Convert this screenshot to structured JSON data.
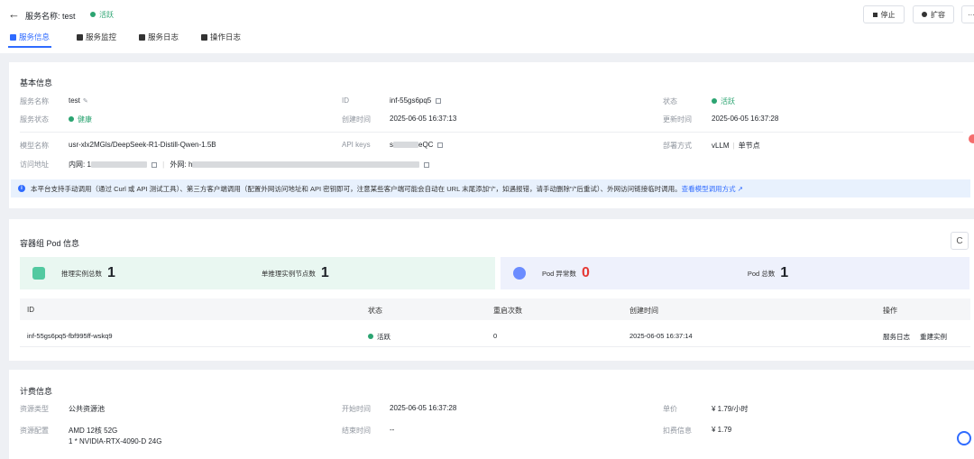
{
  "header": {
    "back_glyph": "←",
    "title": "服务名称: test",
    "status": "活跃",
    "stop_label": "停止",
    "scale_label": "扩容",
    "more_label": "···"
  },
  "tabs": [
    {
      "label": "服务信息"
    },
    {
      "label": "服务监控"
    },
    {
      "label": "服务日志"
    },
    {
      "label": "操作日志"
    }
  ],
  "basic": {
    "title": "基本信息",
    "service_name_label": "服务名称",
    "service_name_value": "test",
    "id_label": "ID",
    "id_value": "inf-55gs6pq5",
    "status_label": "状态",
    "status_value": "活跃",
    "service_state_label": "服务状态",
    "service_state_value": "健康",
    "created_label": "创建时间",
    "created_value": "2025-06-05 16:37:13",
    "updated_label": "更新时间",
    "updated_value": "2025-06-05 16:37:28",
    "model_label": "模型名称",
    "model_value": "usr-xlx2MGls/DeepSeek-R1-Distill-Qwen-1.5B",
    "apikey_label": "API keys",
    "apikey_prefix": "s",
    "apikey_suffix": "eQC",
    "deploy_label": "部署方式",
    "deploy_value": "vLLM",
    "deploy_mode": "单节点",
    "access_label": "访问地址",
    "inner_label": "内网:",
    "inner_prefix": "1",
    "outer_label": "外网:",
    "outer_prefix": "h",
    "notice_text": "本平台支持手动调用（通过 Curl 或 API 测试工具）、第三方客户端调用（配置外网访问地址和 API 密钥即可，注意某些客户端可能会自动在 URL 末尾添加\"/\"，如遇报错，请手动删除\"/\"后重试）、外网访问链接临时调用。",
    "notice_link": "查看模型调用方式"
  },
  "pod": {
    "title": "容器组 Pod 信息",
    "refresh_glyph": "C",
    "total_label": "推理实例总数",
    "total_value": "1",
    "nodes_label": "单推理实例节点数",
    "nodes_value": "1",
    "abnormal_label": "Pod 异常数",
    "abnormal_value": "0",
    "pod_total_label": "Pod 总数",
    "pod_total_value": "1",
    "columns": [
      "ID",
      "状态",
      "重启次数",
      "创建时间",
      "操作"
    ],
    "rows": [
      {
        "id": "inf-55gs6pq5-fbf995ff-wskq9",
        "status": "活跃",
        "restarts": "0",
        "created": "2025-06-05 16:37:14",
        "action_logs": "服务日志",
        "action_rebuild": "重建实例"
      }
    ]
  },
  "billing": {
    "title": "计费信息",
    "res_type_label": "资源类型",
    "res_type_value": "公共资源池",
    "start_label": "开始时间",
    "start_value": "2025-06-05 16:37:28",
    "price_label": "单价",
    "price_value": "¥ 1.79/小时",
    "res_conf_label": "资源配置",
    "res_conf_line1": "AMD 12核 52G",
    "res_conf_line2": "1 * NVIDIA-RTX-4090-D 24G",
    "end_label": "结束时间",
    "end_value": "--",
    "deduct_label": "扣费信息",
    "deduct_value": "¥ 1.79"
  },
  "colors": {
    "accent": "#2f6bff",
    "success": "#2ba471",
    "danger": "#e53935"
  }
}
